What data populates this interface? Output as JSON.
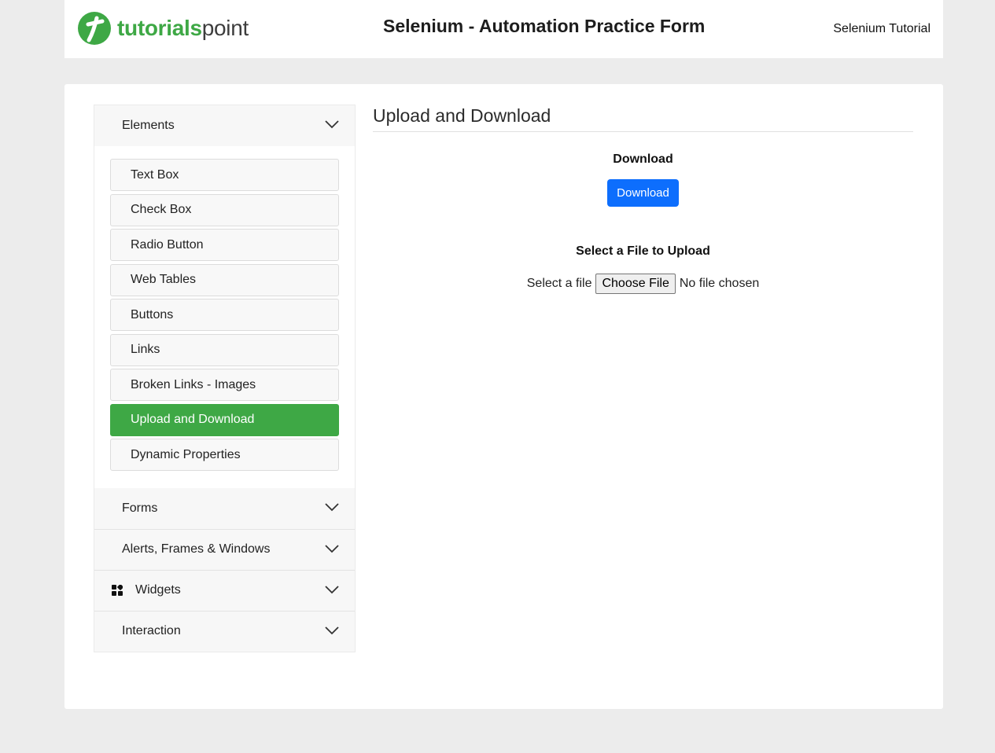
{
  "header": {
    "logo_bold": "tutorials",
    "logo_light": "point",
    "logo_icon": "tutorialspoint-logo-icon",
    "title": "Selenium - Automation Practice Form",
    "link": "Selenium Tutorial"
  },
  "sidebar": {
    "sections": [
      {
        "label": "Elements",
        "expanded": true
      },
      {
        "label": "Forms",
        "expanded": false
      },
      {
        "label": "Alerts, Frames & Windows",
        "expanded": false
      },
      {
        "label": "Widgets",
        "expanded": false,
        "icon": "grid-icon"
      },
      {
        "label": "Interaction",
        "expanded": false
      }
    ],
    "elements_items": [
      {
        "label": "Text Box"
      },
      {
        "label": "Check Box"
      },
      {
        "label": "Radio Button"
      },
      {
        "label": "Web Tables"
      },
      {
        "label": "Buttons"
      },
      {
        "label": "Links"
      },
      {
        "label": "Broken Links - Images"
      },
      {
        "label": "Upload and Download",
        "active": true
      },
      {
        "label": "Dynamic Properties"
      }
    ]
  },
  "main": {
    "title": "Upload and Download",
    "download_heading": "Download",
    "download_button": "Download",
    "upload_heading": "Select a File to Upload",
    "file_label": "Select a file",
    "choose_file_button": "Choose File",
    "file_status": "No file chosen"
  },
  "colors": {
    "accent_green": "#3ea845",
    "primary_blue": "#0d6efd",
    "page_background": "#ececec"
  }
}
